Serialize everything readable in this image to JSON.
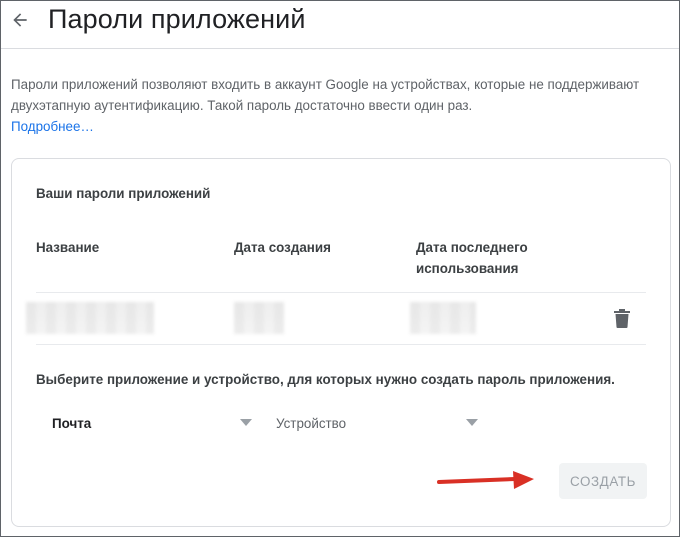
{
  "header": {
    "title": "Пароли приложений"
  },
  "intro": {
    "text": "Пароли приложений позволяют входить в аккаунт Google на устройствах, которые не поддерживают двухэтапную аутентификацию. Такой пароль достаточно ввести один раз.",
    "learn_more": "Подробнее…"
  },
  "card": {
    "title": "Ваши пароли приложений",
    "columns": {
      "name": "Название",
      "created": "Дата создания",
      "last_used": "Дата последнего использования"
    },
    "select_prompt": "Выберите приложение и устройство, для которых нужно создать пароль приложения.",
    "app_select": {
      "value": "Почта"
    },
    "device_select": {
      "value": "Устройство"
    },
    "create_label": "СОЗДАТЬ"
  },
  "colors": {
    "link": "#1a73e8",
    "annotation_arrow": "#d93025",
    "button_disabled_bg": "#f1f3f4",
    "button_disabled_text": "#9aa0a6"
  },
  "icons": {
    "back": "arrow-back-icon",
    "delete": "trash-icon",
    "dropdown": "triangle-down-icon"
  }
}
